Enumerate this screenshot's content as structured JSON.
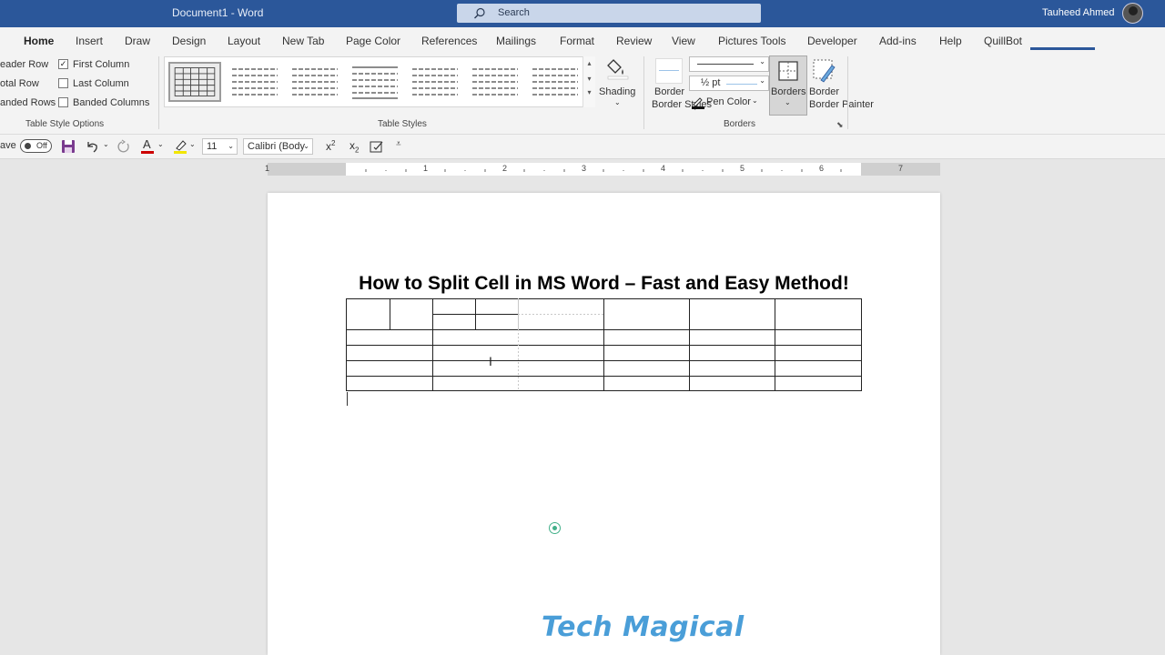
{
  "titlebar": {
    "doc_title": "Document1  -  Word",
    "search_placeholder": "Search",
    "user_name": "Tauheed Ahmed"
  },
  "tabs": [
    "Home",
    "Insert",
    "Draw",
    "Design",
    "Layout",
    "New Tab",
    "Page Color",
    "References",
    "Mailings",
    "Format",
    "Review",
    "View",
    "Pictures Tools",
    "Developer",
    "Add-ins",
    "Help",
    "QuillBot"
  ],
  "active_tab": "Home",
  "table_style_options": {
    "items": [
      {
        "label": "eader Row",
        "checked": false
      },
      {
        "label": "otal Row",
        "checked": false
      },
      {
        "label": "anded Rows",
        "checked": false
      },
      {
        "label": "First Column",
        "checked": true
      },
      {
        "label": "Last Column",
        "checked": false
      },
      {
        "label": "Banded Columns",
        "checked": false
      }
    ],
    "group_label": "Table Style Options"
  },
  "table_styles": {
    "group_label": "Table Styles",
    "shading_label": "Shading"
  },
  "borders_group": {
    "border_styles_label": "Border Styles",
    "pen_weight": "½ pt",
    "pen_color_label": "Pen Color",
    "borders_label": "Borders",
    "border_painter_label": "Border Painter",
    "group_label": "Borders",
    "pen_color": "#cc0000"
  },
  "qat": {
    "autosave_label": "ave",
    "autosave_state": "Off",
    "font_size": "11",
    "font_name": "Calibri (Body"
  },
  "ruler_numbers": [
    "1",
    "1",
    "2",
    "3",
    "4",
    "5",
    "6",
    "7"
  ],
  "document": {
    "heading": "How to Split Cell in MS Word – Fast and Easy Method!",
    "watermark": "Tech Magical"
  },
  "colors": {
    "titlebar": "#2b579a",
    "ribbon": "#f3f3f3",
    "accent": "#2b579a",
    "watermark": "#4a9ed8"
  }
}
